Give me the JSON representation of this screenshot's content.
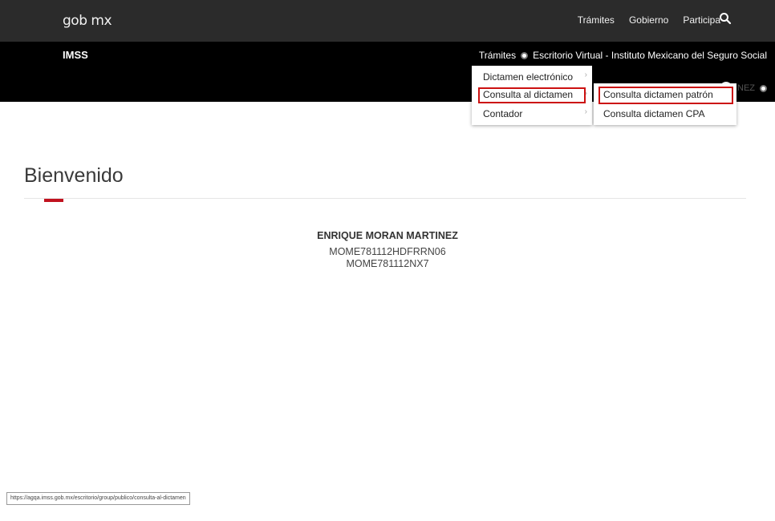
{
  "gob_bar": {
    "logo": "gob mx",
    "nav": [
      "Trámites",
      "Gobierno",
      "Participa"
    ],
    "search_icon": "search-icon"
  },
  "imss_bar": {
    "title": "IMSS",
    "nav_tramites": "Trámites",
    "nav_escritorio": "Escritorio Virtual - Instituto Mexicano del Seguro Social",
    "user_name_partial": "NEZ"
  },
  "menu_primary": {
    "items": [
      "Dictamen electrónico",
      "Consulta al dictamen",
      "Contador"
    ]
  },
  "menu_secondary": {
    "items": [
      "Consulta dictamen patrón",
      "Consulta dictamen CPA"
    ]
  },
  "main": {
    "title": "Bienvenido",
    "user_name": "ENRIQUE MORAN MARTINEZ",
    "curp": "MOME781112HDFRRN06",
    "rfc": "MOME781112NX7"
  },
  "status_bar": {
    "url": "https://agqa.imss.gob.mx/escritorio/group/publico/consulta-al-dictamen"
  },
  "colors": {
    "gob_bar": "#2b2b2b",
    "imss_bar": "#000000",
    "accent": "#c1121f",
    "highlight_box": "#cc1111"
  }
}
